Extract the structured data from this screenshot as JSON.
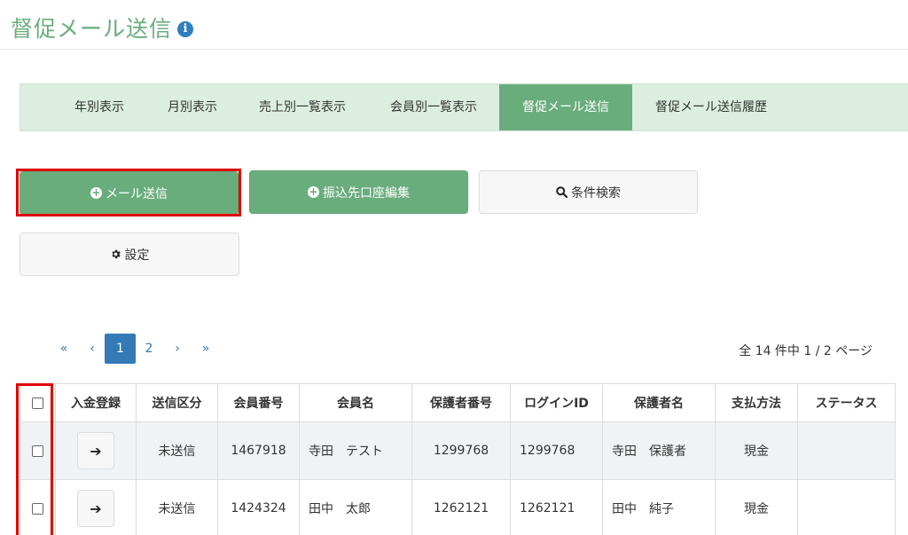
{
  "header": {
    "title": "督促メール送信",
    "info_icon": "info-icon"
  },
  "tabs": [
    {
      "label": "年別表示"
    },
    {
      "label": "月別表示"
    },
    {
      "label": "売上別一覧表示"
    },
    {
      "label": "会員別一覧表示"
    },
    {
      "label": "督促メール送信",
      "active": true
    },
    {
      "label": "督促メール送信履歴"
    }
  ],
  "actions": {
    "send_mail": "メール送信",
    "edit_account": "振込先口座編集",
    "search": "条件検索",
    "settings": "設定"
  },
  "pagination": {
    "first": "«",
    "prev": "‹",
    "pages": [
      "1",
      "2"
    ],
    "current": "1",
    "next": "›",
    "last": "»",
    "info": "全 14 件中 1 / 2 ページ"
  },
  "table": {
    "headers": [
      "入金登録",
      "送信区分",
      "会員番号",
      "会員名",
      "保護者番号",
      "ログインID",
      "保護者名",
      "支払方法",
      "ステータス"
    ],
    "rows": [
      {
        "status_send": "未送信",
        "member_no": "1467918",
        "member_name": "寺田　テスト",
        "guardian_no": "1299768",
        "login_id": "1299768",
        "guardian_name": "寺田　保護者",
        "payment": "現金",
        "status": ""
      },
      {
        "status_send": "未送信",
        "member_no": "1424324",
        "member_name": "田中　太郎",
        "guardian_no": "1262121",
        "login_id": "1262121",
        "guardian_name": "田中　純子",
        "payment": "現金",
        "status": ""
      }
    ]
  },
  "colors": {
    "accent": "#6aad7d",
    "tab_bg": "#dbeedf",
    "link": "#337ab7",
    "highlight": "#e00000"
  }
}
